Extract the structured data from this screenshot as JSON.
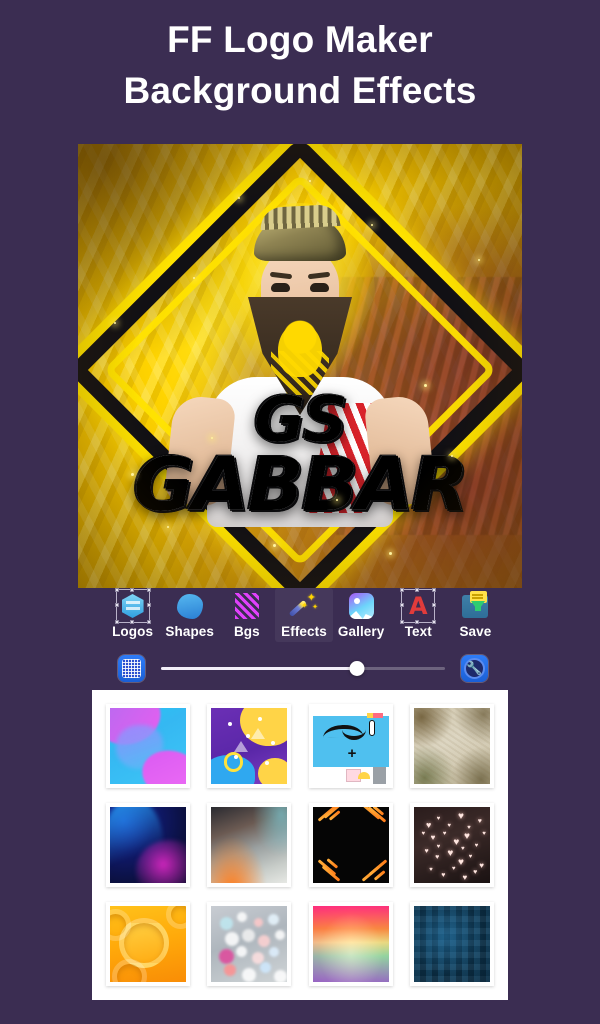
{
  "header": {
    "line1": "FF Logo Maker",
    "line2": "Background Effects"
  },
  "preview": {
    "logo_text_top": "GS",
    "logo_text_bottom": "GABBAR",
    "background_style": "yellow-rays",
    "accent_color": "#ffd400"
  },
  "toolbar": {
    "items": [
      {
        "label": "Logos",
        "icon": "hexagon-logo-icon",
        "active": false
      },
      {
        "label": "Shapes",
        "icon": "blob-shape-icon",
        "active": false
      },
      {
        "label": "Bgs",
        "icon": "stripes-pattern-icon",
        "active": false
      },
      {
        "label": "Effects",
        "icon": "magic-wand-icon",
        "active": true
      },
      {
        "label": "Gallery",
        "icon": "photo-icon",
        "active": false
      },
      {
        "label": "Text",
        "icon": "letter-a-icon",
        "active": false
      },
      {
        "label": "Save",
        "icon": "save-folder-icon",
        "active": false
      }
    ]
  },
  "slider": {
    "left_icon": "pattern-swatch-icon",
    "right_icon": "settings-wrench-icon",
    "value": 69,
    "min": 0,
    "max": 100
  },
  "grid": {
    "background_color": "#ffffff",
    "thumbnails": [
      {
        "name": "fluid-cyan-pink-gradient",
        "class": "t1"
      },
      {
        "name": "memphis-purple-yellow",
        "class": "t2"
      },
      {
        "name": "flat-blue-doodle",
        "class": "t3"
      },
      {
        "name": "beige-grunge-paper",
        "class": "t4"
      },
      {
        "name": "navy-blue-magenta-curve",
        "class": "t5"
      },
      {
        "name": "orange-teal-smoke",
        "class": "t6"
      },
      {
        "name": "black-orange-corner-rays",
        "class": "t7"
      },
      {
        "name": "bokeh-hearts",
        "class": "t8"
      },
      {
        "name": "orange-paper-circles",
        "class": "t9"
      },
      {
        "name": "gray-colored-bokeh",
        "class": "t10"
      },
      {
        "name": "rainbow-gradient",
        "class": "t11"
      },
      {
        "name": "dark-teal-mosaic",
        "class": "t12"
      }
    ]
  },
  "colors": {
    "page_background": "#3b2d52",
    "panel_white": "#ffffff",
    "slider_blue": "#2f7cf6",
    "text_white": "#ffffff"
  }
}
